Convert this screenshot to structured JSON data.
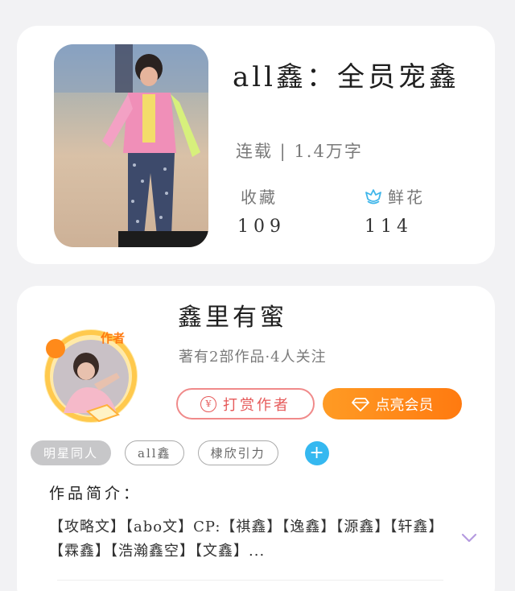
{
  "book": {
    "title": "all鑫：全员宠鑫",
    "serial_info": "连载 | 1.4万字",
    "favorites_label": "收藏",
    "favorites_value": "109",
    "flowers_label": "鲜花",
    "flowers_value": "114",
    "flower_icon": "flower-icon"
  },
  "author": {
    "name": "鑫里有蜜",
    "meta": "著有2部作品·4人关注",
    "badge": "作者",
    "tip_label": "打赏作者",
    "tip_icon": "¥",
    "vip_label": "点亮会员",
    "vip_icon": "diamond-icon"
  },
  "tags": [
    "明星同人",
    "all鑫",
    "棣欣引力"
  ],
  "add_tag_icon": "+",
  "intro": {
    "title": "作品简介：",
    "text": "【攻略文】【abo文】CP:【祺鑫】【逸鑫】【源鑫】【轩鑫】【霖鑫】【浩瀚鑫空】【文鑫】..."
  },
  "colors": {
    "accent_orange": "#ff8a1a",
    "tip_red": "#e65a5a",
    "add_blue": "#35b8f0",
    "chevron_purple": "#b59be0"
  }
}
